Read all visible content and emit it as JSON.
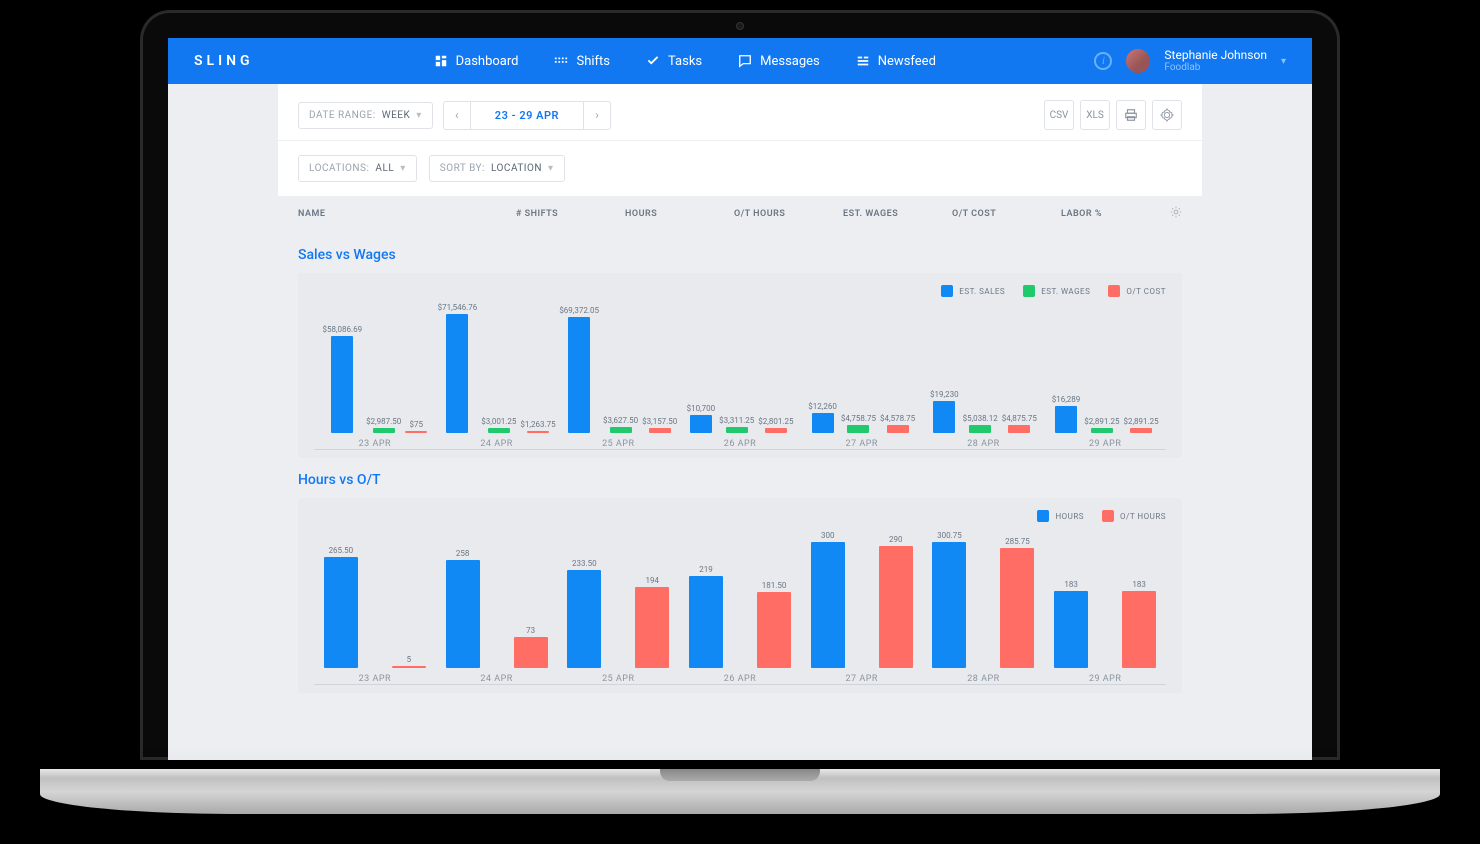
{
  "app": {
    "name": "SLING"
  },
  "nav": {
    "items": [
      {
        "label": "Dashboard",
        "icon": "dashboard-icon"
      },
      {
        "label": "Shifts",
        "icon": "shifts-icon"
      },
      {
        "label": "Tasks",
        "icon": "tasks-icon"
      },
      {
        "label": "Messages",
        "icon": "messages-icon"
      },
      {
        "label": "Newsfeed",
        "icon": "newsfeed-icon"
      }
    ]
  },
  "user": {
    "name": "Stephanie Johnson",
    "company": "Foodlab"
  },
  "toolbar": {
    "date_range_label": "DATE RANGE:",
    "date_range_value": "WEEK",
    "date_range": "23 - 29 APR",
    "csv": "CSV",
    "xls": "XLS",
    "locations_label": "LOCATIONS:",
    "locations_value": "ALL",
    "sort_label": "SORT BY:",
    "sort_value": "LOCATION"
  },
  "columns": {
    "c0": "NAME",
    "c1": "# SHIFTS",
    "c2": "HOURS",
    "c3": "O/T HOURS",
    "c4": "EST. WAGES",
    "c5": "O/T COST",
    "c6": "LABOR %"
  },
  "chart1": {
    "title": "Sales vs Wages",
    "legend": {
      "a": "EST. SALES",
      "b": "EST. WAGES",
      "c": "O/T COST"
    }
  },
  "chart2": {
    "title": "Hours vs O/T",
    "legend": {
      "a": "HOURS",
      "b": "O/T HOURS"
    }
  },
  "chart_data": [
    {
      "type": "bar",
      "title": "Sales vs Wages",
      "categories": [
        "23 APR",
        "24 APR",
        "25 APR",
        "26 APR",
        "27 APR",
        "28 APR",
        "29 APR"
      ],
      "series": [
        {
          "name": "EST. SALES",
          "color": "#1189f5",
          "values": [
            58086.69,
            71546.76,
            69372.05,
            10700,
            12260,
            19230,
            16289
          ],
          "labels": [
            "$58,086.69",
            "$71,546.76",
            "$69,372.05",
            "$10,700",
            "$12,260",
            "$19,230",
            "$16,289"
          ]
        },
        {
          "name": "EST. WAGES",
          "color": "#1fc96c",
          "values": [
            2987.5,
            3001.25,
            3627.5,
            3311.25,
            4758.75,
            5038.12,
            2891.25
          ],
          "labels": [
            "$2,987.50",
            "$3,001.25",
            "$3,627.50",
            "$3,311.25",
            "$4,758.75",
            "$5,038.12",
            "$2,891.25"
          ]
        },
        {
          "name": "O/T COST",
          "color": "#ff6d64",
          "values": [
            75,
            1263.75,
            3157.5,
            2801.25,
            4578.75,
            4875.75,
            2891.25
          ],
          "labels": [
            "$75",
            "$1,263.75",
            "$3,157.50",
            "$2,801.25",
            "$4,578.75",
            "$4,875.75",
            "$2,891.25"
          ]
        }
      ],
      "ylim": [
        0,
        72000
      ]
    },
    {
      "type": "bar",
      "title": "Hours vs O/T",
      "categories": [
        "23 APR",
        "24 APR",
        "25 APR",
        "26 APR",
        "27 APR",
        "28 APR",
        "29 APR"
      ],
      "series": [
        {
          "name": "HOURS",
          "color": "#1189f5",
          "values": [
            265.5,
            258,
            233.5,
            219,
            300,
            300.75,
            183
          ],
          "labels": [
            "265.50",
            "258",
            "233.50",
            "219",
            "300",
            "300.75",
            "183"
          ]
        },
        {
          "name": "O/T HOURS",
          "color": "#ff6d64",
          "values": [
            5,
            73,
            194,
            181.5,
            290,
            285.75,
            183
          ],
          "labels": [
            "5",
            "73",
            "194",
            "181.50",
            "290",
            "285.75",
            "183"
          ]
        }
      ],
      "ylim": [
        0,
        310
      ]
    }
  ]
}
